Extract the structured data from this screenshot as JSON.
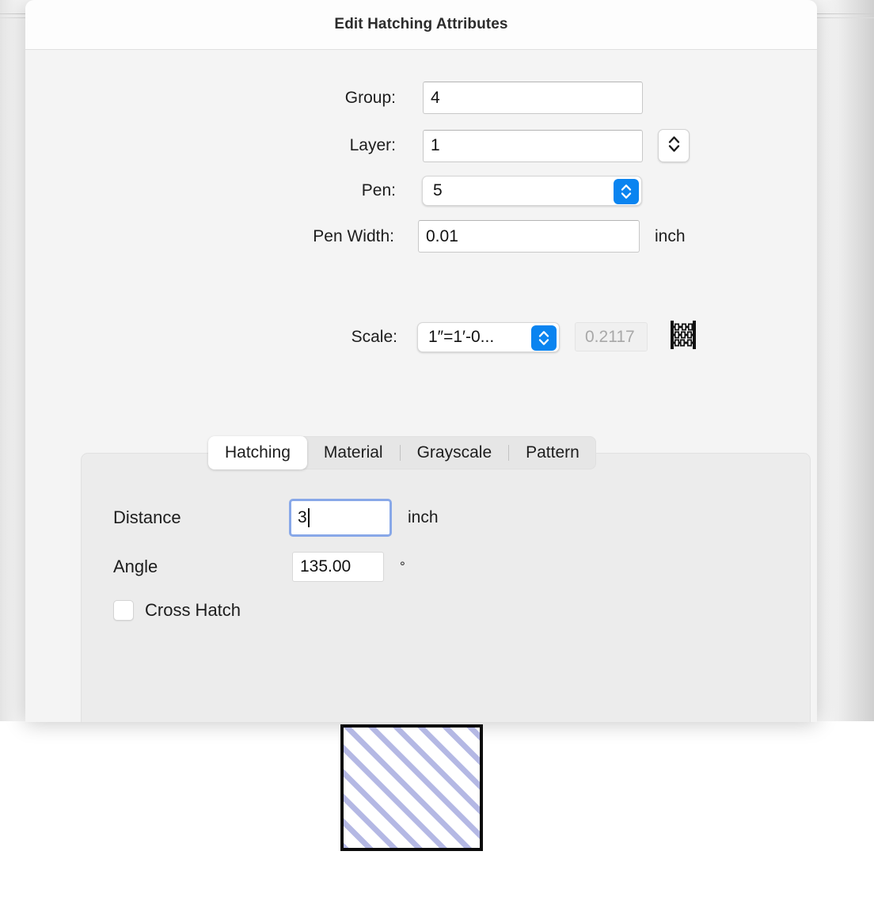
{
  "window": {
    "title": "Edit Hatching Attributes"
  },
  "form": {
    "group": {
      "label": "Group:",
      "value": "4"
    },
    "layer": {
      "label": "Layer:",
      "value": "1",
      "stepper_icon": "up-down-chevron-icon"
    },
    "pen": {
      "label": "Pen:",
      "value": "5",
      "popup_icon": "up-down-chevron-icon"
    },
    "pen_width": {
      "label": "Pen Width:",
      "value": "0.01",
      "unit": "inch"
    },
    "scale": {
      "label": "Scale:",
      "value": "1″=1′-0...",
      "popup_icon": "up-down-chevron-icon",
      "computed_value": "0.2117",
      "calculator_icon": "abacus-icon"
    }
  },
  "tabs": [
    {
      "label": "Hatching",
      "selected": true
    },
    {
      "label": "Material",
      "selected": false
    },
    {
      "label": "Grayscale",
      "selected": false
    },
    {
      "label": "Pattern",
      "selected": false
    }
  ],
  "hatching_panel": {
    "distance": {
      "label": "Distance",
      "value": "3",
      "unit": "inch",
      "focused": true
    },
    "angle": {
      "label": "Angle",
      "value": "135.00",
      "unit": "°"
    },
    "cross_hatch": {
      "label": "Cross Hatch",
      "checked": false
    }
  },
  "preview": {
    "hatch_color": "#b4b8e4",
    "border_color": "#0c0c0c",
    "fill_color": "#ffffff",
    "angle_degrees": "135.00"
  },
  "colors": {
    "accent_blue": "#0a84f0",
    "focus_ring": "#88a8e8",
    "dialog_body": "#f4f4f4",
    "tab_panel": "#ececec",
    "text": "#1d1d1d",
    "disabled_text": "#a8a8a8"
  }
}
